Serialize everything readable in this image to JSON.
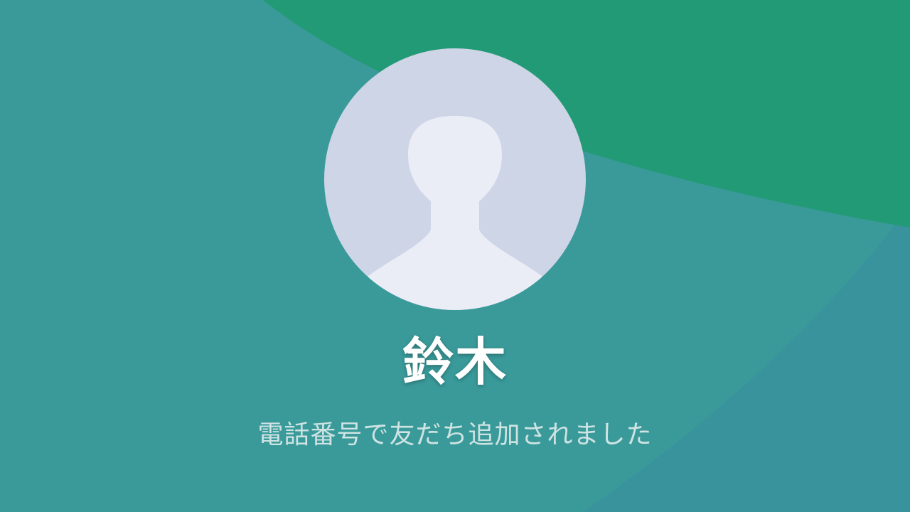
{
  "contact": {
    "name": "鈴木",
    "message": "電話番号で友だち追加されました"
  },
  "avatar": {
    "icon": "default-person-icon"
  },
  "colors": {
    "background_teal": "#3a9a9a",
    "background_green": "#239a76",
    "background_blue": "#3a92a0",
    "avatar_bg": "#ced5e6",
    "avatar_silhouette": "#eaedf6"
  }
}
